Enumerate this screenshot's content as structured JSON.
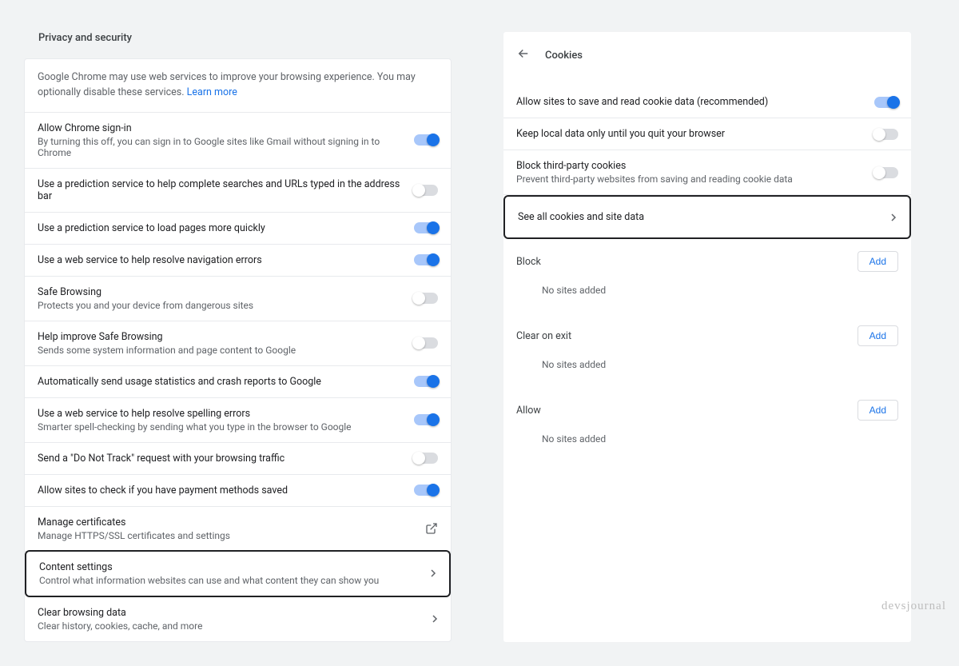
{
  "left": {
    "title": "Privacy and security",
    "intro_before": "Google Chrome may use web services to improve your browsing experience. You may optionally disable these services. ",
    "intro_link": "Learn more",
    "rows": [
      {
        "title": "Allow Chrome sign-in",
        "sub": "By turning this off, you can sign in to Google sites like Gmail without signing in to Chrome",
        "ctrl": "toggle",
        "on": true
      },
      {
        "title": "Use a prediction service to help complete searches and URLs typed in the address bar",
        "ctrl": "toggle",
        "on": false
      },
      {
        "title": "Use a prediction service to load pages more quickly",
        "ctrl": "toggle",
        "on": true
      },
      {
        "title": "Use a web service to help resolve navigation errors",
        "ctrl": "toggle",
        "on": true
      },
      {
        "title": "Safe Browsing",
        "sub": "Protects you and your device from dangerous sites",
        "ctrl": "toggle",
        "on": false
      },
      {
        "title": "Help improve Safe Browsing",
        "sub": "Sends some system information and page content to Google",
        "ctrl": "toggle",
        "on": false
      },
      {
        "title": "Automatically send usage statistics and crash reports to Google",
        "ctrl": "toggle",
        "on": true
      },
      {
        "title": "Use a web service to help resolve spelling errors",
        "sub": "Smarter spell-checking by sending what you type in the browser to Google",
        "ctrl": "toggle",
        "on": true
      },
      {
        "title": "Send a \"Do Not Track\" request with your browsing traffic",
        "ctrl": "toggle",
        "on": false
      },
      {
        "title": "Allow sites to check if you have payment methods saved",
        "ctrl": "toggle",
        "on": true
      },
      {
        "title": "Manage certificates",
        "sub": "Manage HTTPS/SSL certificates and settings",
        "ctrl": "external"
      },
      {
        "title": "Content settings",
        "sub": "Control what information websites can use and what content they can show you",
        "ctrl": "chevron",
        "highlighted": true
      },
      {
        "title": "Clear browsing data",
        "sub": "Clear history, cookies, cache, and more",
        "ctrl": "chevron"
      }
    ]
  },
  "right": {
    "header": "Cookies",
    "rows": [
      {
        "title": "Allow sites to save and read cookie data (recommended)",
        "ctrl": "toggle",
        "on": true
      },
      {
        "title": "Keep local data only until you quit your browser",
        "ctrl": "toggle",
        "on": false
      },
      {
        "title": "Block third-party cookies",
        "sub": "Prevent third-party websites from saving and reading cookie data",
        "ctrl": "toggle",
        "on": false
      }
    ],
    "see_all": "See all cookies and site data",
    "groups": [
      {
        "title": "Block",
        "add": "Add",
        "empty": "No sites added"
      },
      {
        "title": "Clear on exit",
        "add": "Add",
        "empty": "No sites added"
      },
      {
        "title": "Allow",
        "add": "Add",
        "empty": "No sites added"
      }
    ]
  },
  "watermark": "devsjournal"
}
